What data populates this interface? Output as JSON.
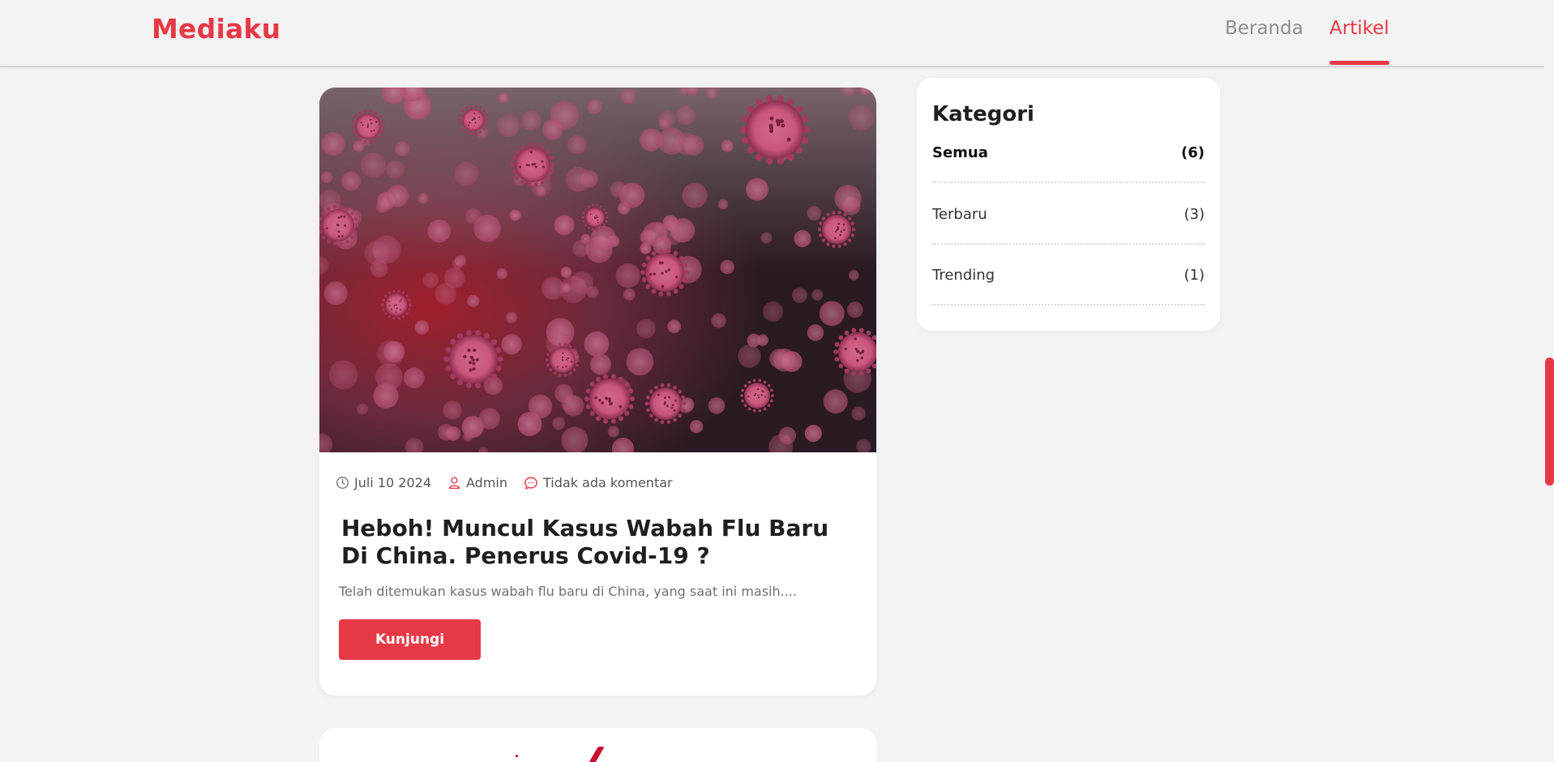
{
  "navbar": {
    "brand": "Mediaku",
    "links": [
      {
        "label": "Beranda",
        "active": false
      },
      {
        "label": "Artikel",
        "active": true
      }
    ]
  },
  "colors": {
    "accent": "#e63946",
    "background": "#f3f3f3",
    "card": "#ffffff"
  },
  "article": {
    "image_icon": "coronavirus-image",
    "date": "Juli 10 2024",
    "author": "Admin",
    "comments": "Tidak ada komentar",
    "title": "Heboh! Muncul Kasus Wabah Flu Baru Di China. Penerus Covid-19 ?",
    "excerpt": "Telah ditemukan kasus wabah flu baru di China, yang saat ini masih....",
    "button_label": "Kunjungi"
  },
  "sidebar": {
    "heading": "Kategori",
    "categories": [
      {
        "label": "Semua",
        "count": "(6)",
        "active": true
      },
      {
        "label": "Terbaru",
        "count": "(3)",
        "active": false
      },
      {
        "label": "Trending",
        "count": "(1)",
        "active": false
      }
    ]
  }
}
